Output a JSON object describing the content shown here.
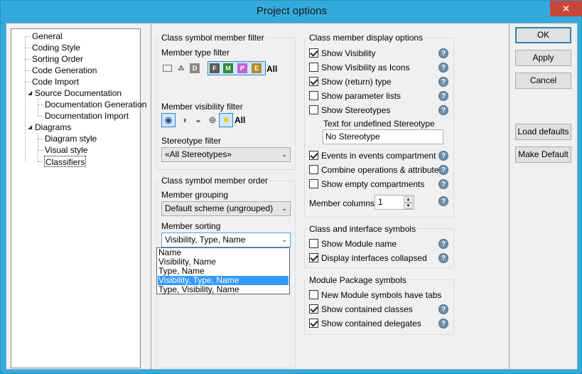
{
  "window": {
    "title": "Project options",
    "close_glyph": "✕"
  },
  "tree": {
    "items": [
      {
        "label": "General"
      },
      {
        "label": "Coding Style"
      },
      {
        "label": "Sorting Order"
      },
      {
        "label": "Code Generation"
      },
      {
        "label": "Code Import"
      },
      {
        "label": "Source Documentation",
        "expanded": true
      },
      {
        "label": "Documentation Generation"
      },
      {
        "label": "Documentation Import"
      },
      {
        "label": "Diagrams",
        "expanded": true
      },
      {
        "label": "Diagram style"
      },
      {
        "label": "Visual style"
      },
      {
        "label": "Classifiers",
        "selected": true
      }
    ],
    "expanded_glyph": "◢"
  },
  "filter": {
    "title": "Class symbol member filter",
    "type_label": "Member type filter",
    "type_icons": [
      {
        "name": "field-icon",
        "glyph": "▭"
      },
      {
        "name": "property-icon",
        "glyph": "⁂"
      },
      {
        "name": "d-icon",
        "glyph": "D",
        "color": "#8a8a8a"
      },
      {
        "name": "f-icon",
        "glyph": "F",
        "color": "#5a5a5a"
      },
      {
        "name": "m-icon",
        "glyph": "M",
        "color": "#2e8b3a"
      },
      {
        "name": "p-icon",
        "glyph": "P",
        "color": "#c060d0"
      },
      {
        "name": "e-icon",
        "glyph": "E",
        "color": "#b58a30"
      }
    ],
    "type_all": "All",
    "visibility_label": "Member visibility filter",
    "visibility_icons": [
      {
        "name": "public-icon",
        "glyph": "◉"
      },
      {
        "name": "protected-icon",
        "glyph": "◑"
      },
      {
        "name": "package-icon",
        "glyph": "◒"
      },
      {
        "name": "private-icon",
        "glyph": "⊛"
      },
      {
        "name": "published-icon",
        "glyph": "●",
        "color": "#f0d000"
      }
    ],
    "visibility_all": "All",
    "stereotype_label": "Stereotype filter",
    "stereotype_value": "«All Stereotypes»"
  },
  "order": {
    "title": "Class symbol member order",
    "grouping_label": "Member grouping",
    "grouping_value": "Default scheme (ungrouped)",
    "sorting_label": "Member sorting",
    "sorting_value": "Visibility, Type, Name",
    "sorting_options": [
      "Name",
      "Visibility, Name",
      "Type, Name",
      "Visibility, Type, Name",
      "Type, Visibility, Name"
    ],
    "sorting_selected_index": 3
  },
  "display": {
    "title": "Class member display options",
    "items": [
      {
        "label": "Show Visibility",
        "checked": true
      },
      {
        "label": "Show Visibility as Icons",
        "checked": false
      },
      {
        "label": "Show (return) type",
        "checked": true
      },
      {
        "label": "Show parameter lists",
        "checked": false
      },
      {
        "label": "Show Stereotypes",
        "checked": false
      }
    ],
    "undefined_label": "Text for undefined Stereotype",
    "undefined_value": "No Stereotype",
    "items2": [
      {
        "label": "Events in events compartment",
        "checked": true
      },
      {
        "label": "Combine operations & attributes",
        "checked": false
      },
      {
        "label": "Show empty compartments",
        "checked": false
      }
    ],
    "columns_label": "Member columns",
    "columns_value": "1"
  },
  "interface": {
    "title": "Class and interface symbols",
    "items": [
      {
        "label": "Show Module name",
        "checked": false
      },
      {
        "label": "Display interfaces collapsed",
        "checked": true
      }
    ]
  },
  "module": {
    "title": "Module Package symbols",
    "items": [
      {
        "label": "New Module symbols have tabs",
        "checked": false
      },
      {
        "label": "Show contained classes",
        "checked": true
      },
      {
        "label": "Show contained delegates",
        "checked": true
      }
    ]
  },
  "buttons": {
    "ok": "OK",
    "apply": "Apply",
    "cancel": "Cancel",
    "load_defaults": "Load defaults",
    "make_default": "Make Default"
  },
  "glyphs": {
    "help": "?",
    "down": "▼",
    "up": "▲",
    "combo": "⌄"
  }
}
